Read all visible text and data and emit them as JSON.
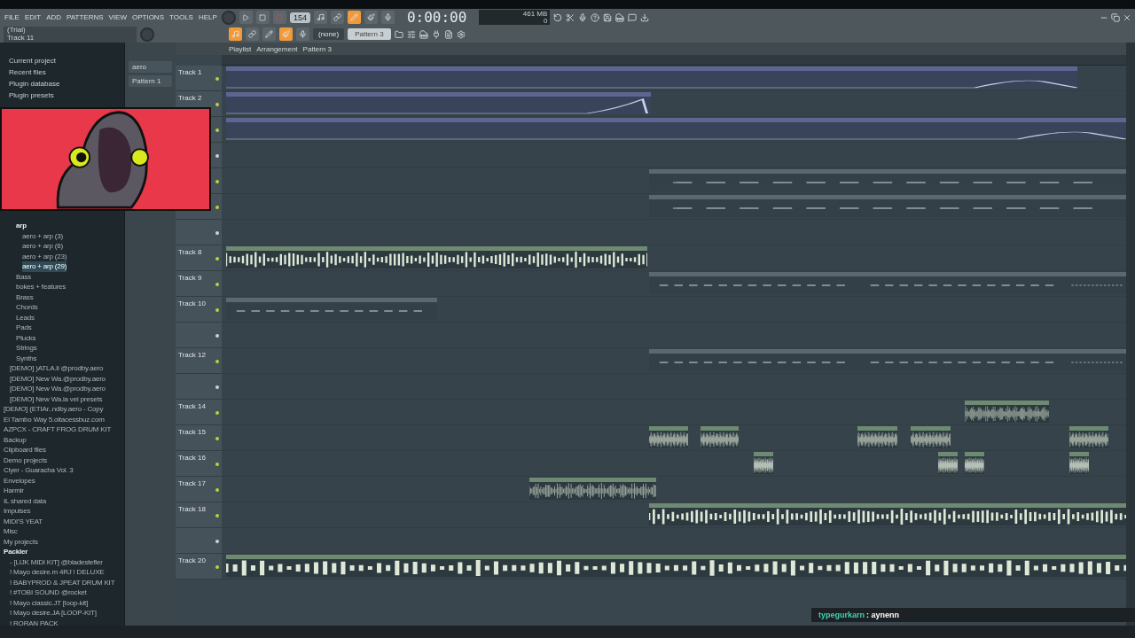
{
  "menu": [
    "FILE",
    "EDIT",
    "ADD",
    "PATTERNS",
    "VIEW",
    "OPTIONS",
    "TOOLS",
    "HELP"
  ],
  "hint": {
    "title": "(Trial)",
    "text": "Track 11"
  },
  "tempo": "154",
  "time": "0:00:00",
  "memory": {
    "value": "461 MB",
    "polyphony": "0"
  },
  "toggles_top": [
    {
      "on": false
    },
    {
      "on": false
    },
    {
      "on": true
    },
    {
      "on": false
    },
    {
      "on": false
    }
  ],
  "toggles_bottom": [
    {
      "on": true
    },
    {
      "on": false
    },
    {
      "on": false
    },
    {
      "on": true
    },
    {
      "on": false
    }
  ],
  "snap": "(none)",
  "pattern_selector": "Pattern 3",
  "playlist": {
    "title": "Playlist",
    "crumbs": [
      "Arrangement",
      "Pattern 3"
    ]
  },
  "browser": {
    "top": [
      "Current project",
      "Recent files",
      "Plugin database",
      "Plugin presets"
    ],
    "folders": [
      {
        "label": "arp",
        "expanded": true,
        "children": [
          {
            "label": "aero + arp (3)",
            "selected": false
          },
          {
            "label": "aero + arp (6)",
            "selected": false
          },
          {
            "label": "aero + arp (23)",
            "selected": false
          },
          {
            "label": "aero + arp (29)",
            "selected": true
          }
        ]
      },
      {
        "label": "Bass",
        "expanded": false
      },
      {
        "label": "bokes + features",
        "expanded": false
      },
      {
        "label": "Brass",
        "expanded": false
      },
      {
        "label": "Chords",
        "expanded": false
      },
      {
        "label": "Leads",
        "expanded": false
      },
      {
        "label": "Pads",
        "expanded": false
      },
      {
        "label": "Plucks",
        "expanded": false
      },
      {
        "label": "Strings",
        "expanded": false
      },
      {
        "label": "Synths",
        "expanded": false
      }
    ],
    "demos": [
      "[DEMO] )ATLA.li @prodby.aero",
      "[DEMO] New Wa.@prodby.aero",
      "[DEMO] New Wa.@prodby.aero",
      "[DEMO] New Wa.la vei presets"
    ],
    "roots": [
      {
        "label": "[DEMO] (ETIAr..ndby.aero - Copy",
        "expanded": false
      },
      {
        "label": "El Tambo Way 5.oitacessbuz.com",
        "expanded": false
      },
      {
        "label": "AZPCX - CRAFT FROG DRUM KIT",
        "expanded": false
      },
      {
        "label": "Backup",
        "expanded": false
      },
      {
        "label": "Clipboard files",
        "expanded": false
      },
      {
        "label": "Demo projects",
        "expanded": false
      },
      {
        "label": "Clyer - Guaracha Vol. 3",
        "expanded": false
      },
      {
        "label": "Envelopes",
        "expanded": false
      },
      {
        "label": "Harmir",
        "expanded": false
      },
      {
        "label": "IL shared data",
        "expanded": false
      },
      {
        "label": "Impulses",
        "expanded": false
      },
      {
        "label": "MIDI'S YEAT",
        "expanded": false
      },
      {
        "label": "Misc",
        "expanded": false
      },
      {
        "label": "My projects",
        "expanded": false
      },
      {
        "label": "Packler",
        "expanded": true,
        "children": [
          {
            "label": "- [LIJK MIDI KIT] @bladestefler",
            "selected": false
          },
          {
            "label": "! Mayo desire.m 4RJ ! DELUXE",
            "selected": false
          },
          {
            "label": "! BABYPROD & JPEAT DRUM KIT",
            "selected": false
          },
          {
            "label": "! #TOBI SOUND @rocket",
            "selected": false
          },
          {
            "label": "! Mayo classic.JT [loop-kit]",
            "selected": false
          },
          {
            "label": "! Mayo desire.JA [LOOP-KIT]",
            "selected": false
          },
          {
            "label": "! RORAN PACK",
            "selected": false
          }
        ]
      }
    ]
  },
  "patterns": [
    "aero",
    "Pattern 1"
  ],
  "tracks": [
    {
      "label": "Track 1",
      "clips": [
        {
          "kind": "automation"
        }
      ]
    },
    {
      "label": "Track 2",
      "clips": [
        {
          "kind": "automation"
        }
      ]
    },
    {
      "clips": [
        {
          "kind": "automation"
        }
      ]
    },
    {
      "kind": "empty"
    },
    {
      "clips": [
        {
          "kind": "pattern"
        }
      ]
    },
    {
      "clips": [
        {
          "kind": "pattern"
        }
      ]
    },
    {
      "kind": "empty"
    },
    {
      "label": "Track 8",
      "clips": [
        {
          "kind": "audio"
        }
      ]
    },
    {
      "label": "Track 9",
      "clips": [
        {
          "kind": "pattern"
        },
        {
          "kind": "pattern"
        },
        {
          "kind": "pattern"
        }
      ]
    },
    {
      "label": "Track 10",
      "clips": [
        {
          "kind": "pattern"
        }
      ]
    },
    {
      "kind": "empty"
    },
    {
      "label": "Track 12",
      "clips": [
        {
          "kind": "pattern"
        },
        {
          "kind": "pattern"
        },
        {
          "kind": "pattern"
        }
      ]
    },
    {
      "kind": "empty"
    },
    {
      "label": "Track 14",
      "clips": [
        {
          "kind": "audio"
        }
      ]
    },
    {
      "label": "Track 15",
      "clips": [
        {
          "kind": "audio"
        },
        {
          "kind": "audio"
        },
        {
          "kind": "audio"
        },
        {
          "kind": "audio"
        },
        {
          "kind": "audio"
        }
      ]
    },
    {
      "label": "Track 16",
      "clips": [
        {
          "kind": "audio"
        },
        {
          "kind": "audio"
        },
        {
          "kind": "audio"
        },
        {
          "kind": "audio"
        }
      ]
    },
    {
      "label": "Track 17",
      "clips": [
        {
          "kind": "audio"
        }
      ]
    },
    {
      "label": "Track 18",
      "clips": [
        {
          "kind": "audio"
        }
      ]
    },
    {
      "kind": "empty"
    },
    {
      "label": "Track 20",
      "clips": [
        {
          "kind": "audio"
        }
      ]
    }
  ],
  "chat": {
    "user": "typegurkarn",
    "message": ": aynenn"
  }
}
